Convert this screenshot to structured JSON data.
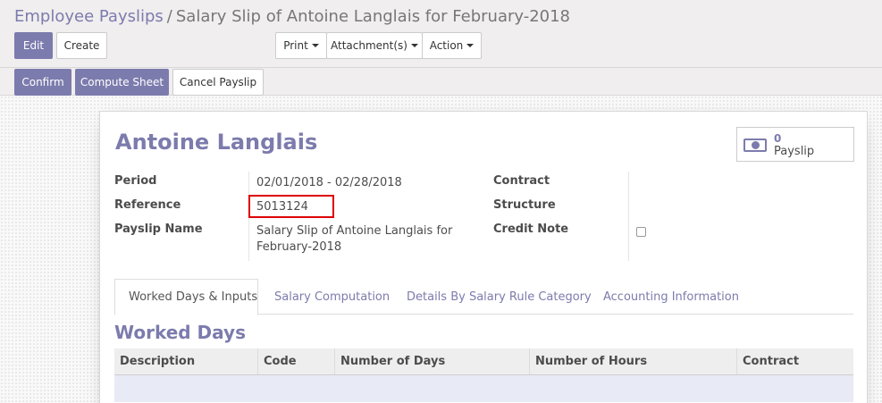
{
  "breadcrumb": {
    "parent": "Employee Payslips",
    "separator": "/",
    "current": "Salary Slip of Antoine Langlais for February-2018"
  },
  "toolbar": {
    "edit_label": "Edit",
    "create_label": "Create",
    "print_label": "Print",
    "attachments_label": "Attachment(s)",
    "action_label": "Action"
  },
  "statusbar": {
    "confirm_label": "Confirm",
    "compute_label": "Compute Sheet",
    "cancel_label": "Cancel Payslip"
  },
  "form": {
    "employee_name": "Antoine Langlais",
    "smart_button": {
      "count": "0",
      "label": "Payslip",
      "icon": "money-icon"
    },
    "fields": {
      "period_label": "Period",
      "period_value": "02/01/2018 - 02/28/2018",
      "reference_label": "Reference",
      "reference_value": "5013124",
      "payslip_name_label": "Payslip Name",
      "payslip_name_line1": "Salary Slip of Antoine Langlais for",
      "payslip_name_line2": "February-2018",
      "contract_label": "Contract",
      "structure_label": "Structure",
      "credit_note_label": "Credit Note",
      "credit_note_checked": false
    }
  },
  "tabs": [
    {
      "label": "Worked Days & Inputs",
      "active": true
    },
    {
      "label": "Salary Computation",
      "active": false
    },
    {
      "label": "Details By Salary Rule Category",
      "active": false
    },
    {
      "label": "Accounting Information",
      "active": false
    }
  ],
  "worked_days": {
    "title": "Worked Days",
    "columns": [
      "Description",
      "Code",
      "Number of Days",
      "Number of Hours",
      "Contract"
    ]
  },
  "colors": {
    "primary": "#7c7bad",
    "highlight_box": "#dd0000"
  }
}
